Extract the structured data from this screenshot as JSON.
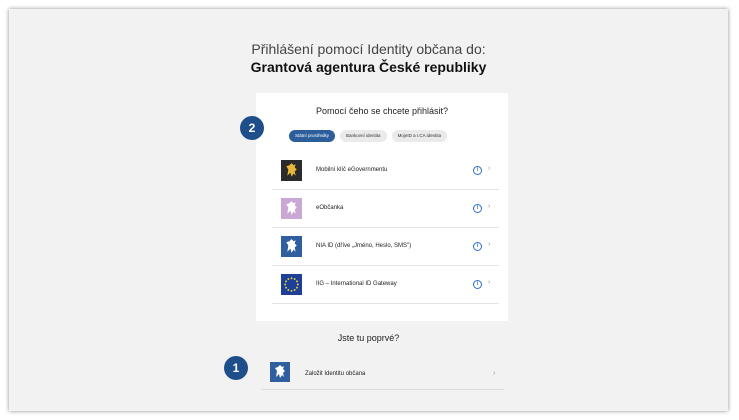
{
  "header": {
    "lead": "Přihlášení pomocí Identity občana do:",
    "org": "Grantová agentura České republiky"
  },
  "login": {
    "title": "Pomocí čeho se chcete přihlásit?",
    "tabs": [
      "Státní prostředky",
      "Bankovní identita",
      "MojeID a I.CA identita"
    ],
    "active_tab": 0,
    "options": [
      {
        "label": "Mobilní klíč eGovernmentu",
        "icon": "czech-lion-dark-icon"
      },
      {
        "label": "eObčanka",
        "icon": "czech-lion-lilac-icon"
      },
      {
        "label": "NIA ID (dříve „Jméno, Heslo, SMS\")",
        "icon": "czech-lion-blue-icon"
      },
      {
        "label": "IIG – International ID Gateway",
        "icon": "eu-flag-icon"
      }
    ]
  },
  "first_time": {
    "title": "Jste tu poprvé?",
    "create_label": "Založit Identitu občana",
    "icon": "czech-lion-blue-icon"
  },
  "badges": {
    "one": "1",
    "two": "2"
  },
  "colors": {
    "accent": "#2c5e9c",
    "badge": "#1f4f8a",
    "background": "#f2f2f2",
    "lion_dark": "#2b2b2b",
    "lion_lilac": "#c9a8d6",
    "lion_blue": "#2f5f9e",
    "eu_blue": "#1d3f97",
    "eu_gold": "#f3d22e"
  }
}
